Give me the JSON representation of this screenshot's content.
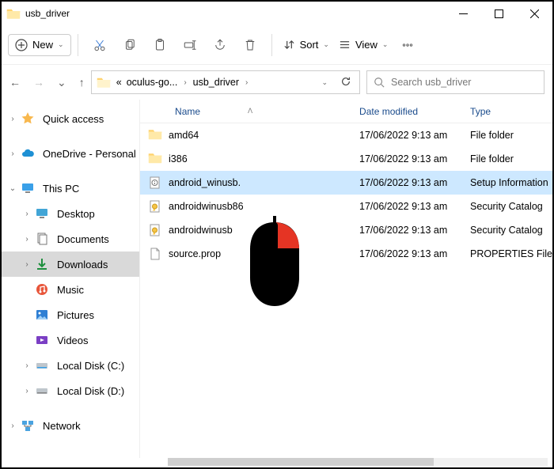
{
  "window": {
    "title": "usb_driver"
  },
  "toolbar": {
    "new_label": "New",
    "sort_label": "Sort",
    "view_label": "View"
  },
  "breadcrumb": {
    "overflow": "«",
    "items": [
      "oculus-go...",
      "usb_driver"
    ]
  },
  "search": {
    "placeholder": "Search usb_driver"
  },
  "sidebar": {
    "quick_access": "Quick access",
    "onedrive": "OneDrive - Personal",
    "this_pc": "This PC",
    "desktop": "Desktop",
    "documents": "Documents",
    "downloads": "Downloads",
    "music": "Music",
    "pictures": "Pictures",
    "videos": "Videos",
    "disk_c": "Local Disk (C:)",
    "disk_d": "Local Disk (D:)",
    "network": "Network"
  },
  "columns": {
    "name": "Name",
    "date": "Date modified",
    "type": "Type"
  },
  "files": [
    {
      "name": "amd64",
      "date": "17/06/2022 9:13 am",
      "type": "File folder",
      "icon": "folder"
    },
    {
      "name": "i386",
      "date": "17/06/2022 9:13 am",
      "type": "File folder",
      "icon": "folder"
    },
    {
      "name": "android_winusb.",
      "date": "17/06/2022 9:13 am",
      "type": "Setup Information",
      "icon": "inf",
      "selected": true
    },
    {
      "name": "androidwinusb86",
      "date": "17/06/2022 9:13 am",
      "type": "Security Catalog",
      "icon": "cat"
    },
    {
      "name": "androidwinusb",
      "date": "17/06/2022 9:13 am",
      "type": "Security Catalog",
      "icon": "cat"
    },
    {
      "name": "source.prop",
      "date": "17/06/2022 9:13 am",
      "type": "PROPERTIES File",
      "icon": "file"
    }
  ]
}
